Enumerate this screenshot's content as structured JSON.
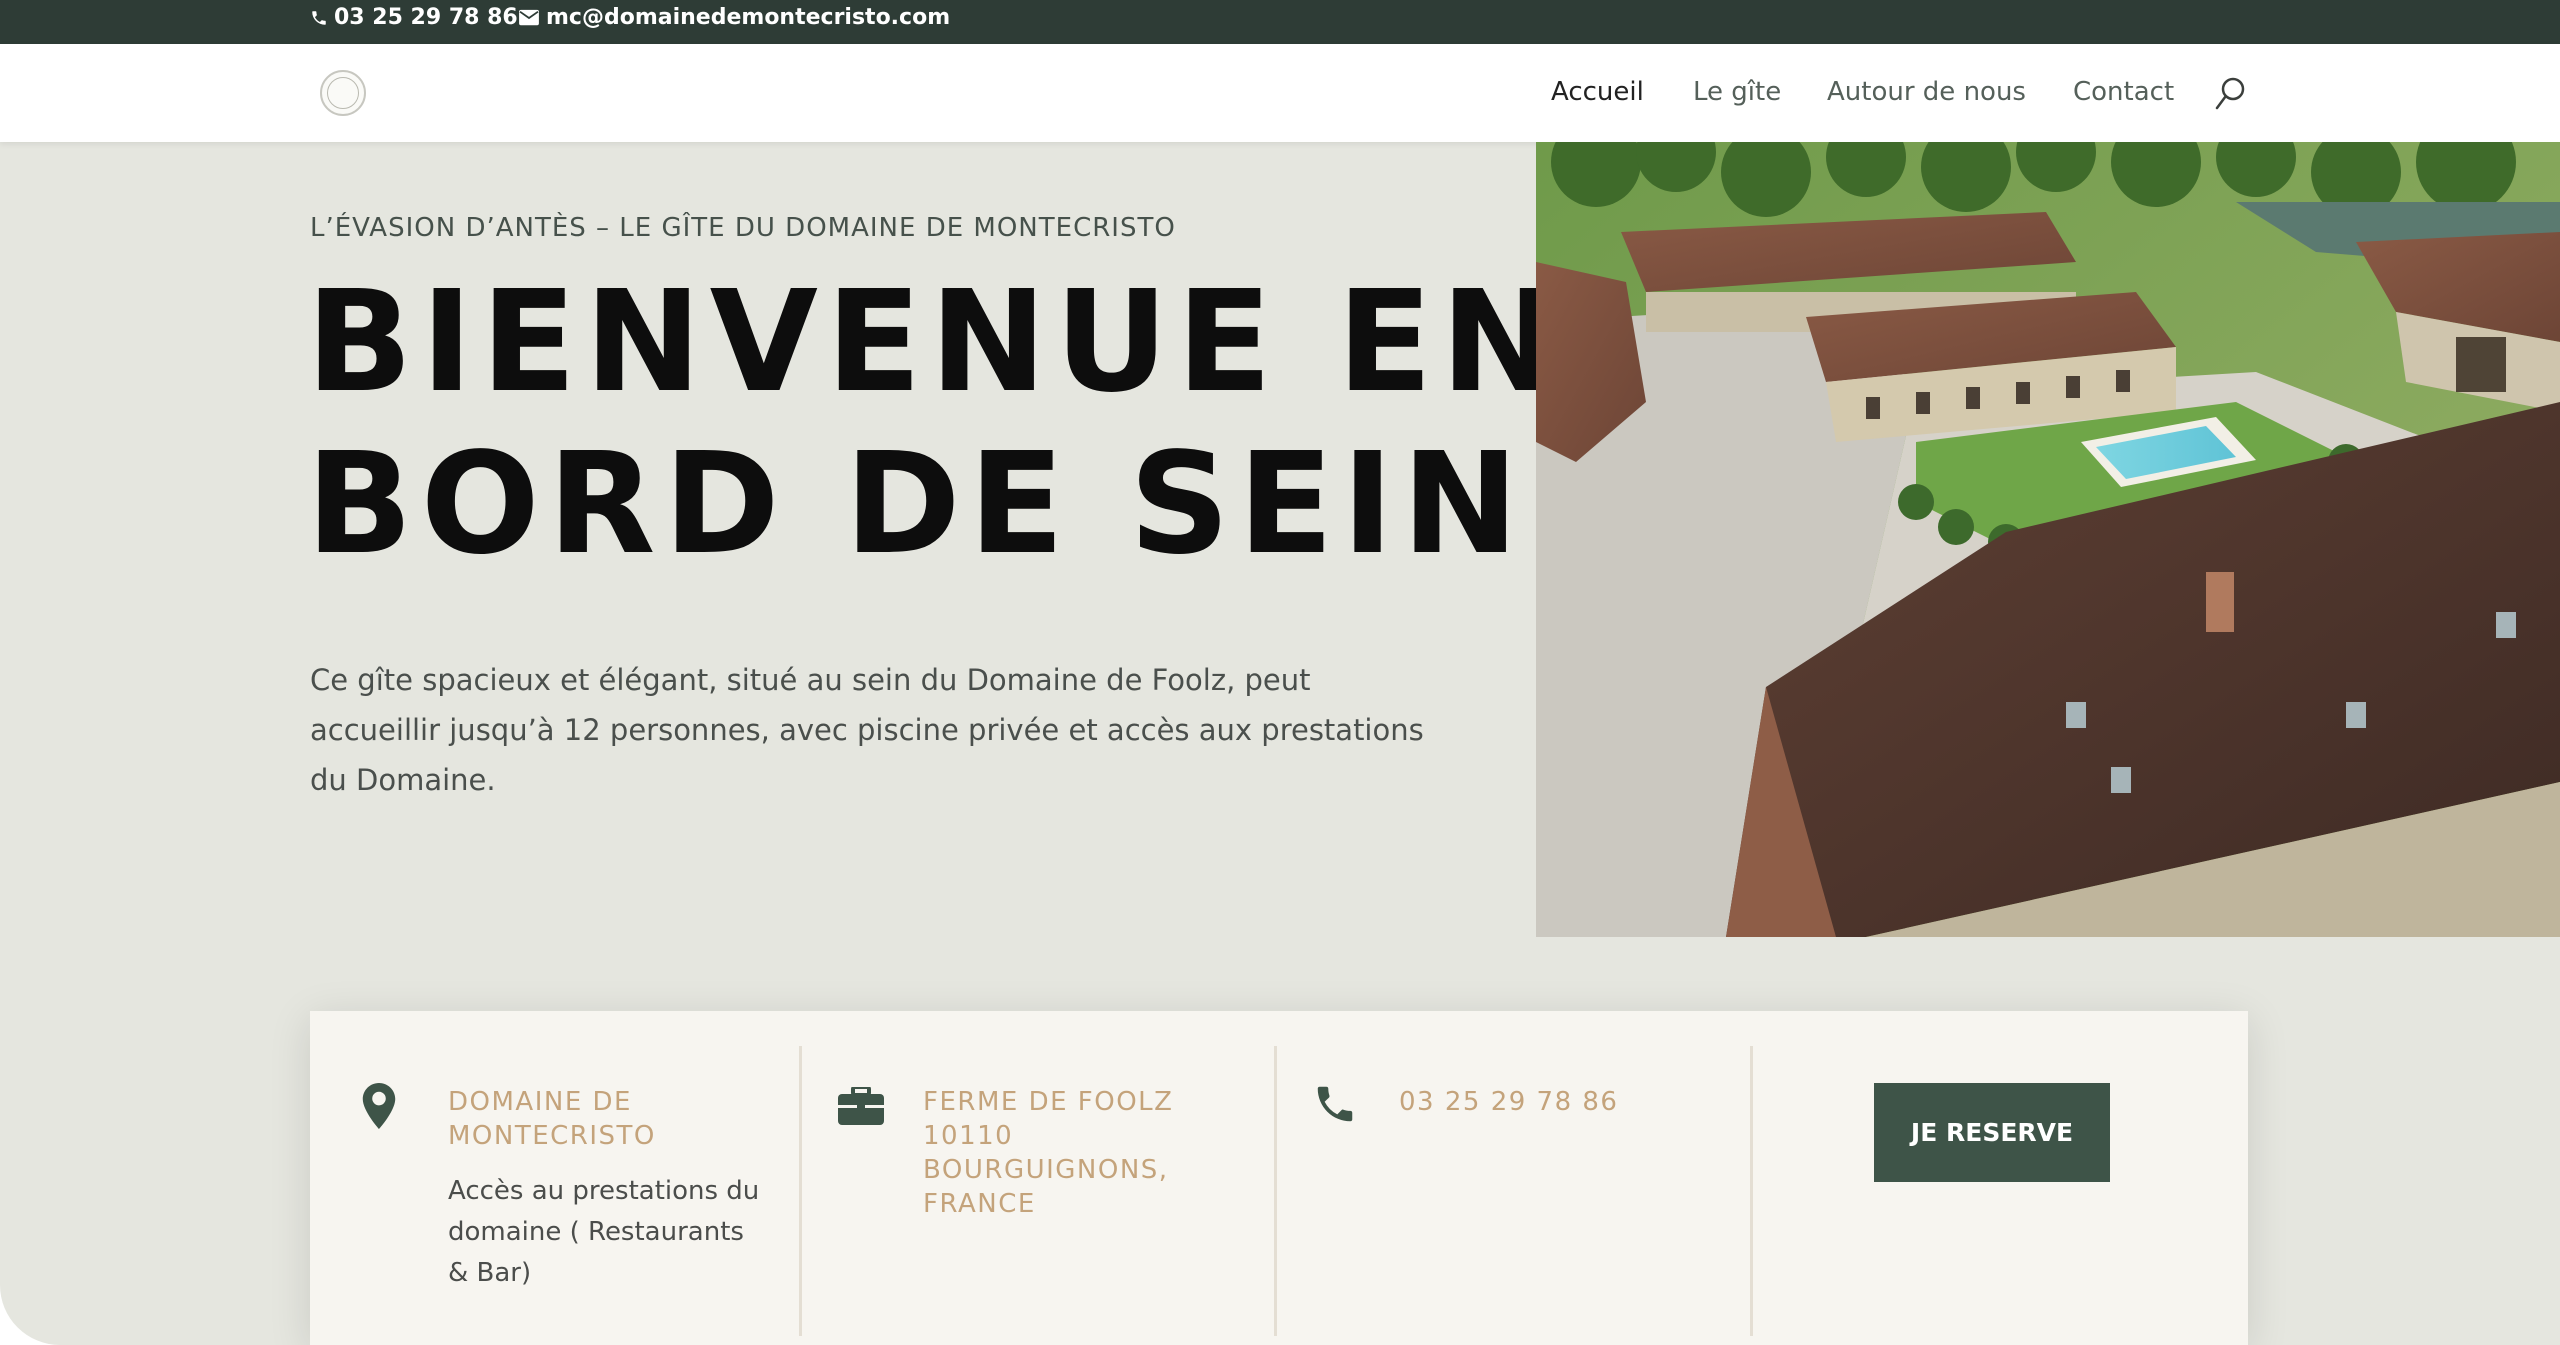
{
  "topbar": {
    "phone": "03 25 29 78 86",
    "email": "mc@domainedemontecristo.com"
  },
  "header": {
    "logo": "Domaine de Montecristo logo",
    "nav": [
      "Accueil",
      "Le gîte",
      "Autour de nous",
      "Contact"
    ],
    "active": "Accueil"
  },
  "hero": {
    "subtitle": "L’ÉVASION D’ANTÈS – LE GÎTE DU DOMAINE DE MONTECRISTO",
    "headline_line1": "BIENVENUE EN",
    "headline_line2": "BORD DE SEINE.",
    "intro": "Ce gîte spacieux et élégant, situé au sein du Domaine de Foolz, peut accueillir jusqu’à 12 personnes, avec piscine privée et accès aux prestations du Domaine."
  },
  "info": {
    "col1_title": "DOMAINE DE MONTECRISTO",
    "col1_desc": "Accès au prestations du domaine ( Restaurants & Bar)",
    "col2_title": "FERME DE FOOLZ 10110 BOURGUIGNONS, FRANCE",
    "col3_title": "03 25 29 78 86",
    "reserve_label": "JE RESERVE"
  },
  "icons": {
    "phone": "phone-icon",
    "mail": "mail-icon",
    "search": "search-icon",
    "location": "map-pin-icon",
    "briefcase": "briefcase-icon"
  },
  "colors": {
    "topbar": "#2e3c36",
    "accent_gold": "#c4a37b",
    "button": "#3e5448",
    "background": "#e5e6df",
    "card": "#f7f5f0"
  }
}
